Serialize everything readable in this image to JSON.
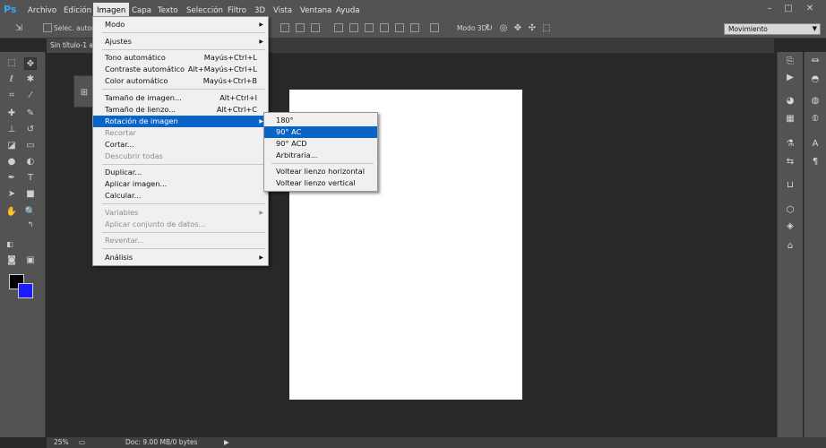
{
  "app": {
    "logo": "Ps"
  },
  "menubar": {
    "items": [
      "Archivo",
      "Edición",
      "Imagen",
      "Capa",
      "Texto",
      "Selección",
      "Filtro",
      "3D",
      "Vista",
      "Ventana",
      "Ayuda"
    ],
    "active": "Imagen",
    "window_controls": [
      "–",
      "□",
      "✕"
    ]
  },
  "options_bar": {
    "auto_select_label": "Selec. autom.:",
    "mode3d_label": "Modo 3D:",
    "workspace": "Movimiento"
  },
  "document": {
    "tab_title": "Sin título-1 al"
  },
  "status_bar": {
    "zoom": "25%",
    "doc_info": "Doc: 9.00 MB/0 bytes"
  },
  "image_menu": {
    "items": [
      {
        "label": "Modo",
        "shortcut": "",
        "submenu": true,
        "disabled": false
      },
      {
        "label": "Ajustes",
        "shortcut": "",
        "submenu": true,
        "disabled": false
      },
      {
        "label": "Tono automático",
        "shortcut": "Mayús+Ctrl+L",
        "submenu": false,
        "disabled": false
      },
      {
        "label": "Contraste automático",
        "shortcut": "Alt+Mayús+Ctrl+L",
        "submenu": false,
        "disabled": false
      },
      {
        "label": "Color automático",
        "shortcut": "Mayús+Ctrl+B",
        "submenu": false,
        "disabled": false
      },
      {
        "label": "Tamaño de imagen...",
        "shortcut": "Alt+Ctrl+I",
        "submenu": false,
        "disabled": false
      },
      {
        "label": "Tamaño de lienzo...",
        "shortcut": "Alt+Ctrl+C",
        "submenu": false,
        "disabled": false
      },
      {
        "label": "Rotación de imagen",
        "shortcut": "",
        "submenu": true,
        "disabled": false,
        "highlighted": true
      },
      {
        "label": "Recortar",
        "shortcut": "",
        "submenu": false,
        "disabled": true
      },
      {
        "label": "Cortar...",
        "shortcut": "",
        "submenu": false,
        "disabled": false
      },
      {
        "label": "Descubrir todas",
        "shortcut": "",
        "submenu": false,
        "disabled": true
      },
      {
        "label": "Duplicar...",
        "shortcut": "",
        "submenu": false,
        "disabled": false
      },
      {
        "label": "Aplicar imagen...",
        "shortcut": "",
        "submenu": false,
        "disabled": false
      },
      {
        "label": "Calcular...",
        "shortcut": "",
        "submenu": false,
        "disabled": false
      },
      {
        "label": "Variables",
        "shortcut": "",
        "submenu": true,
        "disabled": true
      },
      {
        "label": "Aplicar conjunto de datos...",
        "shortcut": "",
        "submenu": false,
        "disabled": true
      },
      {
        "label": "Reventar...",
        "shortcut": "",
        "submenu": false,
        "disabled": true
      },
      {
        "label": "Análisis",
        "shortcut": "",
        "submenu": true,
        "disabled": false
      }
    ]
  },
  "rotation_submenu": {
    "items": [
      {
        "label": "180°",
        "highlighted": false
      },
      {
        "label": "90° AC",
        "highlighted": true
      },
      {
        "label": "90° ACD",
        "highlighted": false
      },
      {
        "label": "Arbitraria...",
        "highlighted": false
      },
      {
        "label": "Voltear lienzo horizontal",
        "highlighted": false
      },
      {
        "label": "Voltear lienzo vertical",
        "highlighted": false
      }
    ]
  },
  "colors": {
    "foreground": "#000000",
    "background": "#1b1bff",
    "highlight": "#0a64c8"
  }
}
